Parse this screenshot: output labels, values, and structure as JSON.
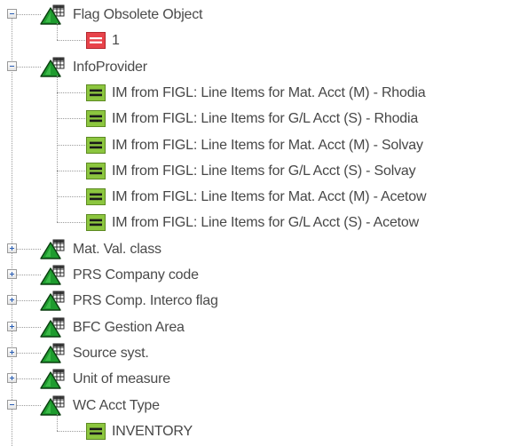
{
  "tree": {
    "nodes": [
      {
        "label": "Flag Obsolete Object",
        "expanded": true,
        "icon": "characteristic-triangle-grid-icon",
        "children": [
          {
            "label": "1",
            "icon": "value-red-icon"
          }
        ]
      },
      {
        "label": "InfoProvider",
        "expanded": true,
        "icon": "characteristic-triangle-grid-icon",
        "children": [
          {
            "label": "IM from FIGL: Line Items for Mat. Acct (M) - Rhodia",
            "icon": "value-green-icon"
          },
          {
            "label": "IM from FIGL: Line Items for G/L Acct (S) - Rhodia",
            "icon": "value-green-icon"
          },
          {
            "label": "IM from FIGL: Line Items for Mat. Acct (M) - Solvay",
            "icon": "value-green-icon"
          },
          {
            "label": "IM from FIGL: Line Items for G/L Acct (S) - Solvay",
            "icon": "value-green-icon"
          },
          {
            "label": "IM from FIGL: Line Items for Mat. Acct (M) - Acetow",
            "icon": "value-green-icon"
          },
          {
            "label": "IM from FIGL: Line Items for G/L Acct (S) - Acetow",
            "icon": "value-green-icon"
          }
        ]
      },
      {
        "label": "Mat. Val. class",
        "expanded": false,
        "icon": "characteristic-triangle-grid-icon",
        "children": []
      },
      {
        "label": "PRS Company code",
        "expanded": false,
        "icon": "characteristic-triangle-grid-icon",
        "children": []
      },
      {
        "label": "PRS Comp. Interco flag",
        "expanded": false,
        "icon": "characteristic-triangle-grid-icon",
        "children": []
      },
      {
        "label": "BFC Gestion Area",
        "expanded": false,
        "icon": "characteristic-triangle-grid-icon",
        "children": []
      },
      {
        "label": "Source syst.",
        "expanded": false,
        "icon": "characteristic-triangle-grid-icon",
        "children": []
      },
      {
        "label": "Unit of measure",
        "expanded": false,
        "icon": "characteristic-triangle-grid-icon",
        "children": []
      },
      {
        "label": "WC Acct Type",
        "expanded": true,
        "icon": "characteristic-triangle-grid-icon",
        "children": [
          {
            "label": "INVENTORY",
            "icon": "value-green-icon"
          }
        ]
      }
    ]
  },
  "colors": {
    "triangle_fill": "#1e9b2e",
    "triangle_stroke": "#0b3d10",
    "value_green": "#8cc63f",
    "value_red": "#e8434a",
    "text": "#4a4a4a",
    "connector": "#9c9c9c"
  }
}
